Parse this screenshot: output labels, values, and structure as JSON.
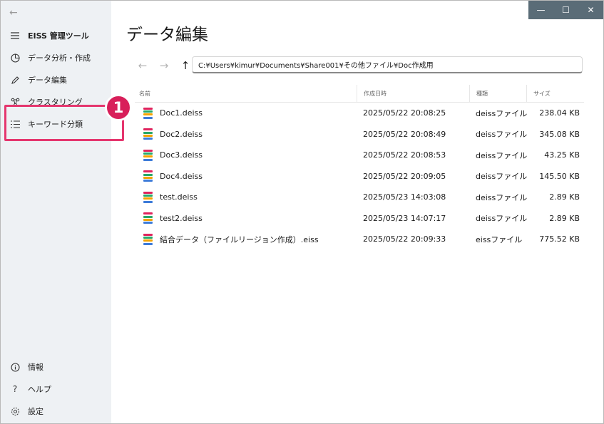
{
  "window": {
    "title_controls": [
      "—",
      "☐",
      "✕"
    ]
  },
  "sidebar": {
    "back_glyph": "←",
    "app_title": "EISS 管理ツール",
    "items": [
      {
        "label": "データ分析・作成",
        "icon": "chart-pie-icon"
      },
      {
        "label": "データ編集",
        "icon": "pencil-icon"
      },
      {
        "label": "クラスタリング",
        "icon": "cluster-icon"
      },
      {
        "label": "キーワード分類",
        "icon": "list-icon"
      }
    ],
    "footer_items": [
      {
        "label": "情報",
        "icon": "info-icon"
      },
      {
        "label": "ヘルプ",
        "icon": "help-icon"
      },
      {
        "label": "設定",
        "icon": "gear-icon"
      }
    ],
    "callout_number": "1"
  },
  "main": {
    "title": "データ編集",
    "path": "C:¥Users¥kimur¥Documents¥Share001¥その他ファイル¥Doc作成用",
    "columns": [
      "名前",
      "作成日時",
      "種類",
      "サイズ"
    ],
    "files": [
      {
        "name": "Doc1.deiss",
        "date": "2025/05/22 20:08:25",
        "type": "deissファイル",
        "size": "238.04 KB"
      },
      {
        "name": "Doc2.deiss",
        "date": "2025/05/22 20:08:49",
        "type": "deissファイル",
        "size": "345.08 KB"
      },
      {
        "name": "Doc3.deiss",
        "date": "2025/05/22 20:08:53",
        "type": "deissファイル",
        "size": "43.25 KB"
      },
      {
        "name": "Doc4.deiss",
        "date": "2025/05/22 20:09:05",
        "type": "deissファイル",
        "size": "145.50 KB"
      },
      {
        "name": "test.deiss",
        "date": "2025/05/23 14:03:08",
        "type": "deissファイル",
        "size": "2.89 KB"
      },
      {
        "name": "test2.deiss",
        "date": "2025/05/23 14:07:17",
        "type": "deissファイル",
        "size": "2.89 KB"
      },
      {
        "name": "結合データ（ファイルリージョン作成）.eiss",
        "date": "2025/05/22 20:09:33",
        "type": "eissファイル",
        "size": "775.52 KB"
      }
    ]
  },
  "colors": {
    "sidebar_bg": "#eef1f4",
    "callout_accent": "#e5366e",
    "titlebar_bg": "#5a6c77",
    "file_icon_stripes": [
      "#e0245e",
      "#2aa86a",
      "#f4a300",
      "#3d7bd9"
    ]
  }
}
